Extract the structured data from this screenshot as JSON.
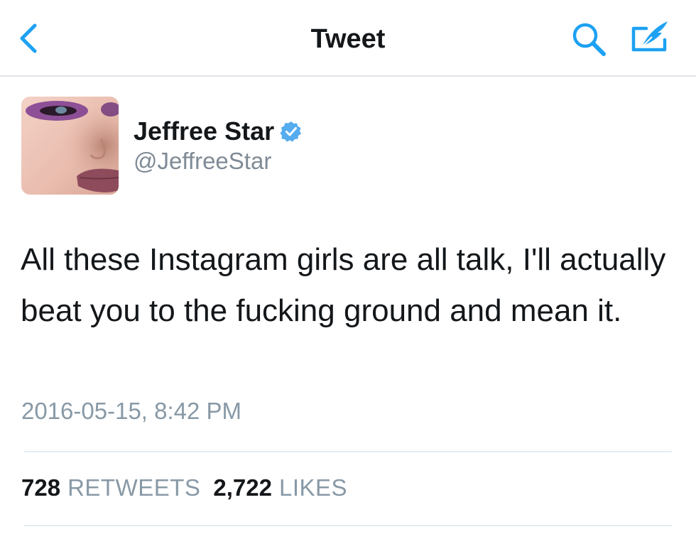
{
  "nav": {
    "back_icon": "chevron-left-icon",
    "title": "Tweet",
    "search_icon": "search-icon",
    "compose_icon": "compose-tweet-icon"
  },
  "tweet": {
    "author_name": "Jeffree Star",
    "verified_icon": "verified-badge-icon",
    "handle": "@JeffreeStar",
    "text": "All these Instagram girls are all talk, I'll actually beat you to the fucking ground and mean it.",
    "timestamp": "2016-05-15, 8:42 PM",
    "retweet_count": "728",
    "retweet_label": "RETWEETS",
    "like_count": "2,722",
    "like_label": "LIKES"
  },
  "colors": {
    "accent": "#1da1f2",
    "secondary_text": "#8899a6",
    "primary_text": "#14171a",
    "divider": "#e6ecf0"
  }
}
